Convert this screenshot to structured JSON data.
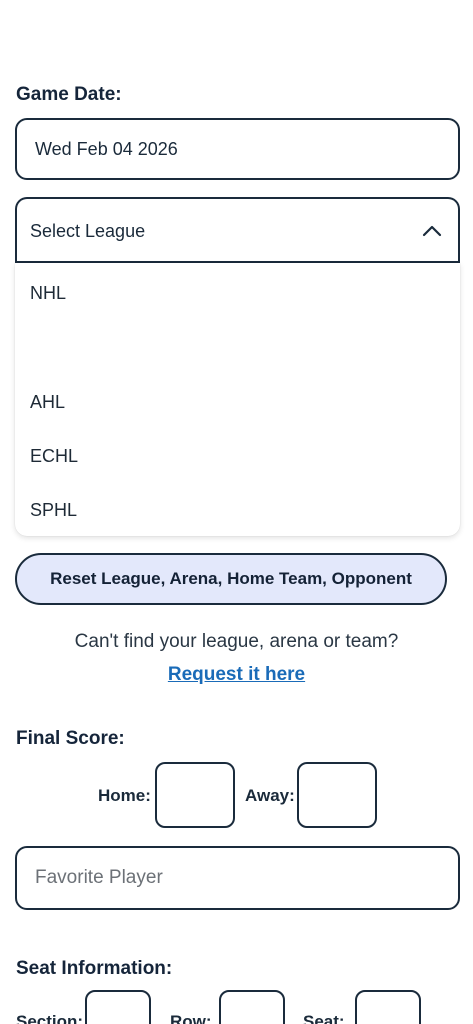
{
  "game_date": {
    "label": "Game Date:",
    "value": "Wed Feb 04 2026"
  },
  "league_select": {
    "placeholder": "Select League",
    "options": [
      "NHL",
      "AHL",
      "ECHL",
      "SPHL"
    ],
    "chevron_icon": "chevron-up-icon"
  },
  "reset_button_label": "Reset League, Arena, Home Team, Opponent",
  "help": {
    "text": "Can't find your league, arena or team?",
    "link": "Request it here",
    "link_color": "#1a6bb8"
  },
  "final_score": {
    "label": "Final Score:",
    "home_label": "Home:",
    "away_label": "Away:"
  },
  "favorite_player": {
    "placeholder": "Favorite Player"
  },
  "seat_info": {
    "label": "Seat Information:",
    "section_label": "Section:",
    "row_label": "Row:",
    "seat_label": "Seat:"
  },
  "colors": {
    "border": "#1a2b3c",
    "reset_button_bg": "#e3e8fb"
  }
}
